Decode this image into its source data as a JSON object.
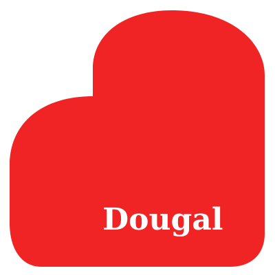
{
  "name": "Dougal",
  "colors": {
    "heart": "#f02424",
    "text": "#ffffff",
    "background": "#ffffff"
  },
  "icon": "heart-icon"
}
